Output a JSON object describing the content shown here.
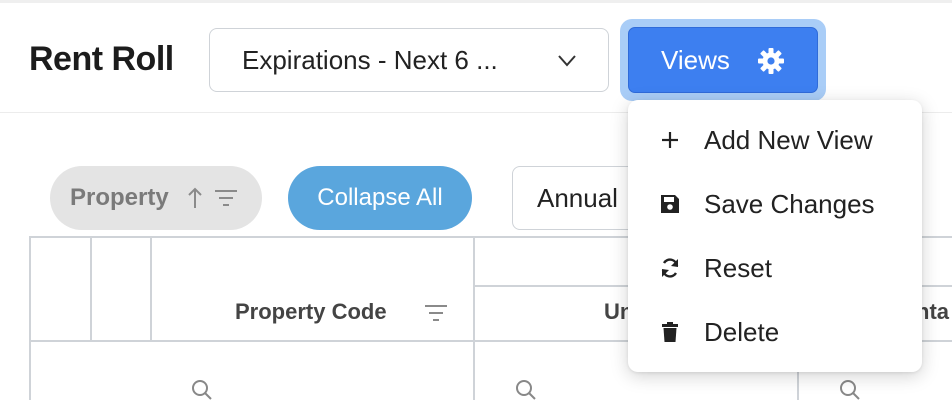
{
  "header": {
    "title": "Rent Roll",
    "view_select_value": "Expirations - Next 6 ...",
    "views_button_label": "Views"
  },
  "toolbar": {
    "property_pill_label": "Property",
    "collapse_all_label": "Collapse All",
    "annual_label": "Annual"
  },
  "table": {
    "columns": [
      {
        "label": "Property Code"
      },
      {
        "label": "Un"
      },
      {
        "label": "nta"
      }
    ]
  },
  "views_menu": {
    "items": [
      {
        "label": "Add New View",
        "icon": "plus-icon"
      },
      {
        "label": "Save Changes",
        "icon": "save-icon"
      },
      {
        "label": "Reset",
        "icon": "refresh-icon"
      },
      {
        "label": "Delete",
        "icon": "trash-icon"
      }
    ]
  },
  "colors": {
    "primary_button": "#3d7ff0",
    "focus_ring": "#a9cdf7",
    "collapse_pill": "#5aa6dd",
    "property_pill": "#e4e4e4"
  }
}
